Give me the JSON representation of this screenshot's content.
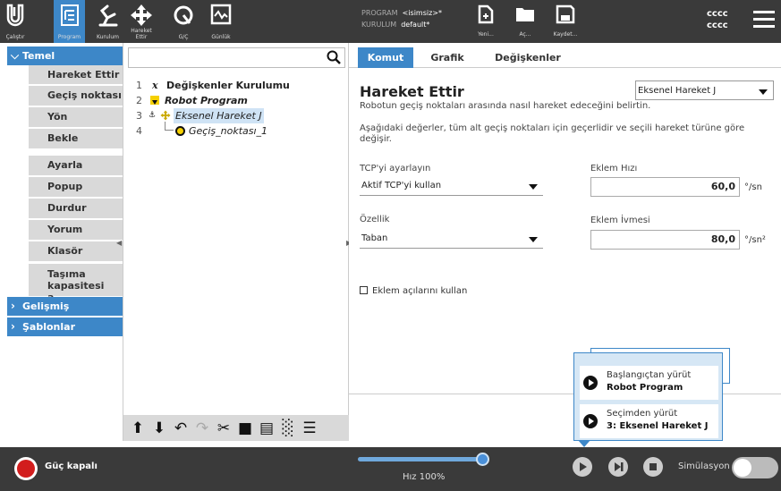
{
  "topbar": {
    "buttons": [
      {
        "label": "Çalıştır",
        "icon": "ur-logo-icon"
      },
      {
        "label": "Program",
        "icon": "program-tree-icon"
      },
      {
        "label": "Kurulum",
        "icon": "robot-arm-icon"
      },
      {
        "label": "Hareket Ettir",
        "icon": "move-cross-icon"
      },
      {
        "label": "G/Ç",
        "icon": "io-icon"
      },
      {
        "label": "Günlük",
        "icon": "log-icon"
      }
    ],
    "program_label": "PROGRAM",
    "program_value": "<isimsiz>*",
    "installation_label": "KURULUM",
    "installation_value": "default*",
    "file_buttons": [
      {
        "label": "Yeni...",
        "icon": "new-file-icon"
      },
      {
        "label": "Aç...",
        "icon": "open-folder-icon"
      },
      {
        "label": "Kaydet...",
        "icon": "save-icon"
      }
    ],
    "user_line1": "cccc",
    "user_line2": "cccc"
  },
  "left_nav": {
    "temel": {
      "label": "Temel"
    },
    "items": [
      {
        "label": "Hareket Ettir"
      },
      {
        "label": "Geçiş noktası"
      },
      {
        "label": "Yön"
      },
      {
        "label": "Bekle"
      },
      {
        "label": "Ayarla"
      },
      {
        "label": "Popup"
      },
      {
        "label": "Durdur"
      },
      {
        "label": "Yorum"
      },
      {
        "label": "Klasör"
      },
      {
        "label": "Taşıma kapasitesi a..."
      }
    ],
    "gelismis": {
      "label": "Gelişmiş"
    },
    "sablonlar": {
      "label": "Şablonlar"
    }
  },
  "tree": {
    "search_placeholder": "",
    "rows": [
      {
        "num": "1",
        "label": "Değişkenler Kurulumu"
      },
      {
        "num": "2",
        "label": "Robot Program"
      },
      {
        "num": "3",
        "label": "Eksenel Hareket J"
      },
      {
        "num": "4",
        "label": "Geçiş_noktası_1"
      }
    ]
  },
  "tabs": [
    {
      "label": "Komut"
    },
    {
      "label": "Grafik"
    },
    {
      "label": "Değişkenler"
    }
  ],
  "command": {
    "title": "Hareket Ettir",
    "move_type": "Eksenel Hareket J",
    "subtitle": "Robotun geçiş noktaları arasında nasıl hareket edeceğini belirtin.",
    "description": "Aşağıdaki değerler, tüm alt geçiş noktaları için geçerlidir ve seçili hareket türüne göre değişir.",
    "tcp_label": "TCP'yi ayarlayın",
    "tcp_value": "Aktif TCP'yi kullan",
    "feature_label": "Özellik",
    "feature_value": "Taban",
    "joint_speed_label": "Eklem Hızı",
    "joint_speed_value": "60,0",
    "joint_speed_unit": "°/sn",
    "joint_accel_label": "Eklem İvmesi",
    "joint_accel_value": "80,0",
    "joint_accel_unit": "°/sn²",
    "use_joint_angles": "Eklem açılarını kullan"
  },
  "popup": {
    "item1_line1": "Başlangıçtan yürüt",
    "item1_line2": "Robot Program",
    "item2_line1": "Seçimden yürüt",
    "item2_line2": "3: Eksenel Hareket J"
  },
  "footer": {
    "power_label": "Güç kapalı",
    "speed_label": "Hız 100%",
    "speed_fraction": 1.0,
    "simulation_label": "Simülasyon"
  },
  "colors": {
    "accent": "#3d87c8",
    "topbar_bg": "#3a3a3a",
    "power_red": "#d21d1d",
    "tree_yellow": "#f5d000"
  }
}
